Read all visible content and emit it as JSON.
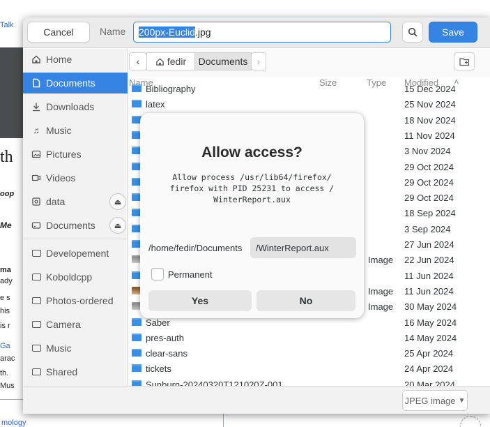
{
  "background": {
    "fragments": [
      "Talk",
      "Se",
      "th",
      "oop",
      "Me",
      "ma",
      "ady",
      "e s",
      "his",
      "is r",
      "Ga",
      "arac",
      "th.",
      "Mus",
      "s",
      "g",
      "o",
      "th",
      "k",
      "is",
      "mology"
    ],
    "lower_link": "mology"
  },
  "header": {
    "cancel_label": "Cancel",
    "name_label": "Name",
    "filename_selected": "200px-Euclid",
    "filename_rest": ".jpg",
    "save_label": "Save"
  },
  "sidebar": {
    "items": [
      {
        "label": "Home",
        "icon": "home-icon"
      },
      {
        "label": "Documents",
        "icon": "document-icon"
      },
      {
        "label": "Downloads",
        "icon": "download-icon"
      },
      {
        "label": "Music",
        "icon": "music-icon"
      },
      {
        "label": "Pictures",
        "icon": "picture-icon"
      },
      {
        "label": "Videos",
        "icon": "video-icon"
      },
      {
        "label": "data",
        "icon": "drive-icon"
      },
      {
        "label": "Documents",
        "icon": "drive-icon"
      },
      {
        "label": "Developement",
        "icon": "folder-icon"
      },
      {
        "label": "Koboldcpp",
        "icon": "folder-icon"
      },
      {
        "label": "Photos-ordered",
        "icon": "folder-icon"
      },
      {
        "label": "Camera",
        "icon": "folder-icon"
      },
      {
        "label": "Music",
        "icon": "folder-icon"
      },
      {
        "label": "Shared",
        "icon": "folder-icon"
      }
    ],
    "active": "Documents"
  },
  "pathbar": {
    "home": "fedir",
    "current": "Documents"
  },
  "columns": {
    "name": "Name",
    "size": "Size",
    "type": "Type",
    "modified": "Modified"
  },
  "files": [
    {
      "name": "Bibliography",
      "type": "",
      "modified": "15 Dec 2024",
      "kind": "folder"
    },
    {
      "name": "latex",
      "type": "",
      "modified": "25 Nov 2024",
      "kind": "folder"
    },
    {
      "name": "",
      "type": "",
      "modified": "18 Nov 2024",
      "kind": "folder"
    },
    {
      "name": "",
      "type": "",
      "modified": "11 Nov 2024",
      "kind": "folder"
    },
    {
      "name": "",
      "type": "",
      "modified": "3 Nov 2024",
      "kind": "folder"
    },
    {
      "name": "",
      "type": "",
      "modified": "29 Oct 2024",
      "kind": "folder"
    },
    {
      "name": "",
      "type": "",
      "modified": "29 Oct 2024",
      "kind": "folder"
    },
    {
      "name": "",
      "type": "",
      "modified": "29 Oct 2024",
      "kind": "folder"
    },
    {
      "name": "",
      "type": "",
      "modified": "18 Sep 2024",
      "kind": "folder"
    },
    {
      "name": "",
      "type": "",
      "modified": "3 Sep 2024",
      "kind": "folder"
    },
    {
      "name": "",
      "type": "",
      "modified": "27 Jun 2024",
      "kind": "folder"
    },
    {
      "name": "",
      "type": "Image",
      "modified": "22 Jun 2024",
      "kind": "image"
    },
    {
      "name": "",
      "type": "",
      "modified": "11 Jun 2024",
      "kind": "folder"
    },
    {
      "name": "",
      "type": "Image",
      "modified": "11 Jun 2024",
      "kind": "image-warm"
    },
    {
      "name": "",
      "type": "Image",
      "modified": "30 May 2024",
      "kind": "image"
    },
    {
      "name": "Saber",
      "type": "",
      "modified": "16 May 2024",
      "kind": "folder"
    },
    {
      "name": "pres-auth",
      "type": "",
      "modified": "14 May 2024",
      "kind": "folder"
    },
    {
      "name": "clear-sans",
      "type": "",
      "modified": "25 Apr 2024",
      "kind": "folder"
    },
    {
      "name": "tickets",
      "type": "",
      "modified": "24 Apr 2024",
      "kind": "folder"
    },
    {
      "name": "Sunburn-20240320T121020Z-001",
      "type": "",
      "modified": "20 Mar 2024",
      "kind": "folder"
    }
  ],
  "footer": {
    "filter_label": "JPEG image"
  },
  "dialog": {
    "title": "Allow access?",
    "body": "Allow process /usr/lib64/firefox/ firefox with PID 25231 to access / WinterReport.aux",
    "body_line1": "Allow process /usr/lib64/firefox/",
    "body_line2": "firefox with PID 25231 to access /",
    "body_line3": "WinterReport.aux",
    "directory": "/home/fedir/Documents",
    "file": "/WinterReport.aux",
    "permanent_label": "Permanent",
    "yes_label": "Yes",
    "no_label": "No"
  }
}
